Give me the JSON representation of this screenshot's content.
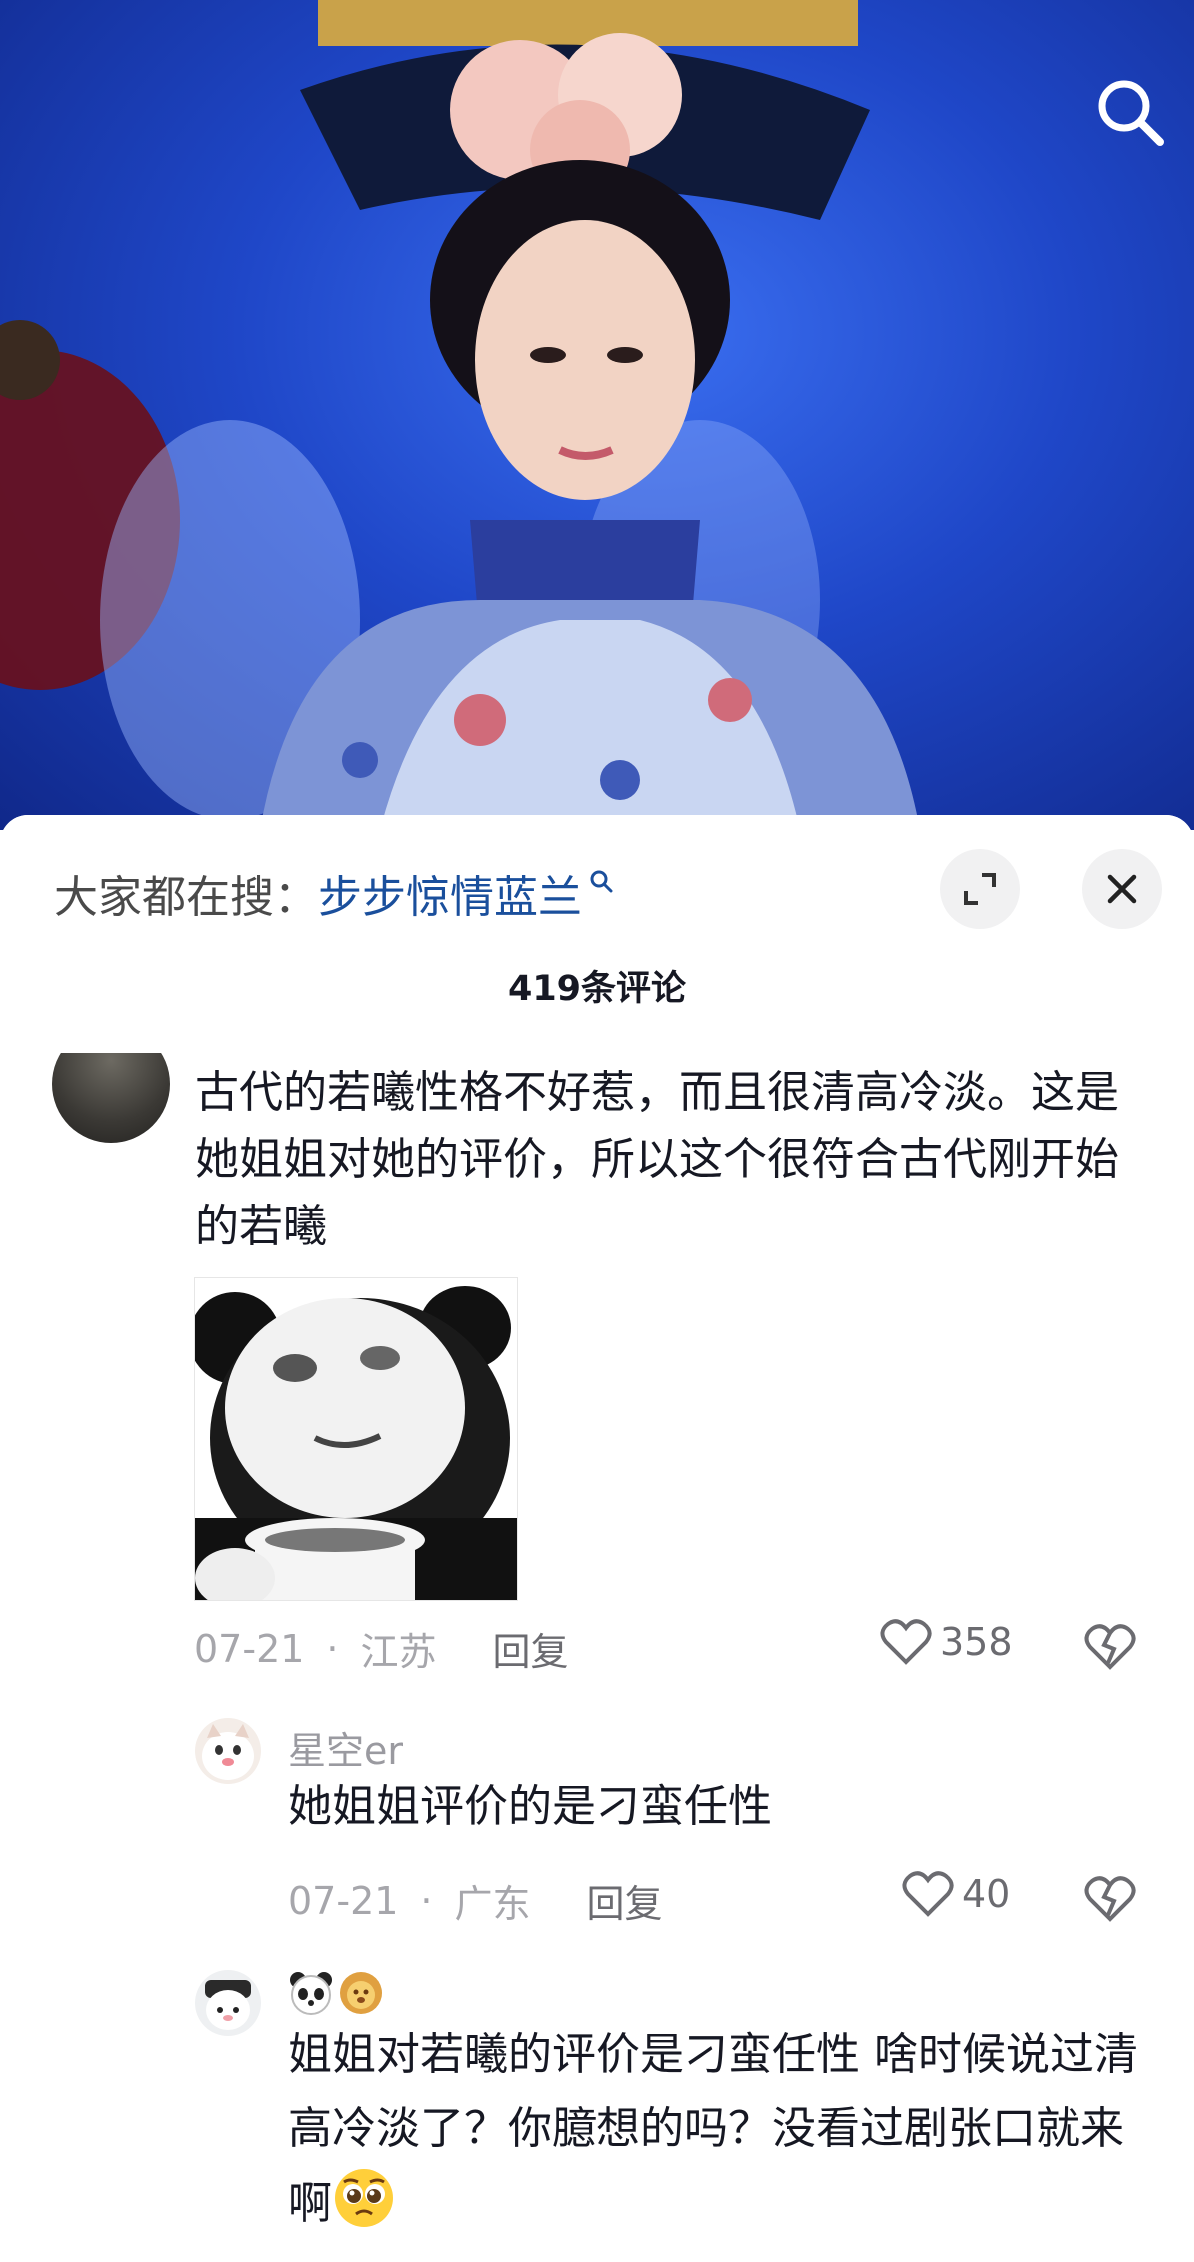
{
  "hot_search": {
    "prefix": "大家都在搜：",
    "term": "步步惊情蓝兰"
  },
  "comment_count": "419条评论",
  "main_comment": {
    "text": "古代的若曦性格不好惹，而且很清高冷淡。这是她姐姐对她的评价，所以这个很符合古代刚开始的若曦",
    "date": "07-21",
    "dot": "·",
    "location": "江苏",
    "reply_label": "回复",
    "likes": "358"
  },
  "replies": [
    {
      "author": "星空er",
      "text": "她姐姐评价的是刁蛮任性",
      "date": "07-21",
      "dot": "·",
      "location": "广东",
      "reply_label": "回复",
      "likes": "40"
    },
    {
      "author_emojis": [
        "panda-emoji",
        "lion-emoji"
      ],
      "text": "姐姐对若曦的评价是刁蛮任性 啥时候说过清高冷淡了？你臆想的吗？没看过剧张口就来啊",
      "trailing_emoji": "pleading-face-emoji"
    }
  ],
  "colors": {
    "hot_term": "#1a4f9c",
    "video_bg": "#1f47c8",
    "meta_gray": "#a6a6ab"
  }
}
